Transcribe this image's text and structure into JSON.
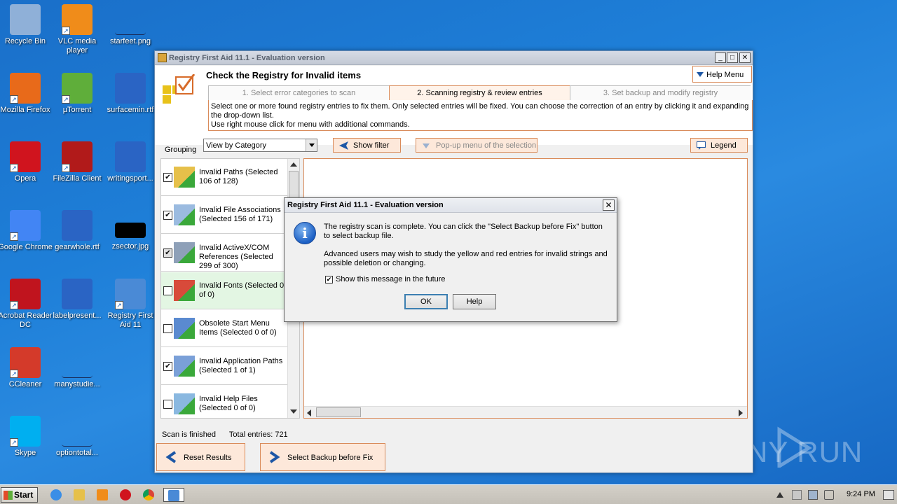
{
  "desktop": {
    "icons": [
      {
        "label": "Recycle Bin"
      },
      {
        "label": "VLC media player"
      },
      {
        "label": "starfeet.png"
      },
      {
        "label": "Mozilla Firefox"
      },
      {
        "label": "µTorrent"
      },
      {
        "label": "surfacemin.rtf"
      },
      {
        "label": "Opera"
      },
      {
        "label": "FileZilla Client"
      },
      {
        "label": "writingsport..."
      },
      {
        "label": "Google Chrome"
      },
      {
        "label": "gearwhole.rtf"
      },
      {
        "label": "zsector.jpg"
      },
      {
        "label": "Acrobat Reader DC"
      },
      {
        "label": "labelpresent..."
      },
      {
        "label": "Registry First Aid 11"
      },
      {
        "label": "CCleaner"
      },
      {
        "label": "manystudie..."
      },
      {
        "label": "Skype"
      },
      {
        "label": "optiontotal..."
      }
    ],
    "watermark": "ANY RUN"
  },
  "window": {
    "title": "Registry First Aid 11.1 - Evaluation version",
    "minimize": "_",
    "maximize": "□",
    "close": "✕",
    "header_title": "Check the Registry for Invalid items",
    "help_menu": "Help Menu",
    "tabs": [
      {
        "label": "1. Select error categories to scan",
        "active": false
      },
      {
        "label": "2. Scanning registry & review entries",
        "active": true
      },
      {
        "label": "3. Set backup and modify registry",
        "active": false
      }
    ],
    "description_line1": "Select one or more found registry entries to fix them. Only selected entries will be fixed. You can choose the correction of an entry by clicking it and expanding the drop-down list.",
    "description_line2": "Use right mouse click for menu with additional commands.",
    "grouping_label": "Grouping",
    "grouping_value": "View by Category",
    "show_filter": "Show filter",
    "popup_menu": "Pop-up menu of the selection",
    "legend": "Legend",
    "categories": [
      {
        "label": "Invalid Paths (Selected 106 of 128)",
        "checked": true,
        "selected": false
      },
      {
        "label": "Invalid File Associations (Selected 156 of 171)",
        "checked": true,
        "selected": false
      },
      {
        "label": "Invalid ActiveX/COM References (Selected 299 of 300)",
        "checked": true,
        "selected": false
      },
      {
        "label": "Invalid Fonts (Selected 0 of 0)",
        "checked": false,
        "selected": true
      },
      {
        "label": "Obsolete Start Menu Items (Selected 0 of 0)",
        "checked": false,
        "selected": false
      },
      {
        "label": "Invalid Application Paths (Selected 1 of 1)",
        "checked": true,
        "selected": false
      },
      {
        "label": "Invalid Help Files (Selected 0 of 0)",
        "checked": false,
        "selected": false
      }
    ],
    "status_text": "Scan is finished",
    "total_entries": "Total entries: 721",
    "reset_results": "Reset Results",
    "select_backup": "Select Backup before Fix"
  },
  "dialog": {
    "title": "Registry First Aid 11.1 - Evaluation version",
    "close": "✕",
    "message1": "The registry scan is complete. You can click the \"Select Backup before Fix\" button to select backup file.",
    "message2": "Advanced users may wish to study the yellow and red entries for invalid strings and possible deletion or changing.",
    "checkbox_label": "Show this message in the future",
    "ok": "OK",
    "help": "Help"
  },
  "taskbar": {
    "start": "Start",
    "clock": "9:24 PM"
  }
}
